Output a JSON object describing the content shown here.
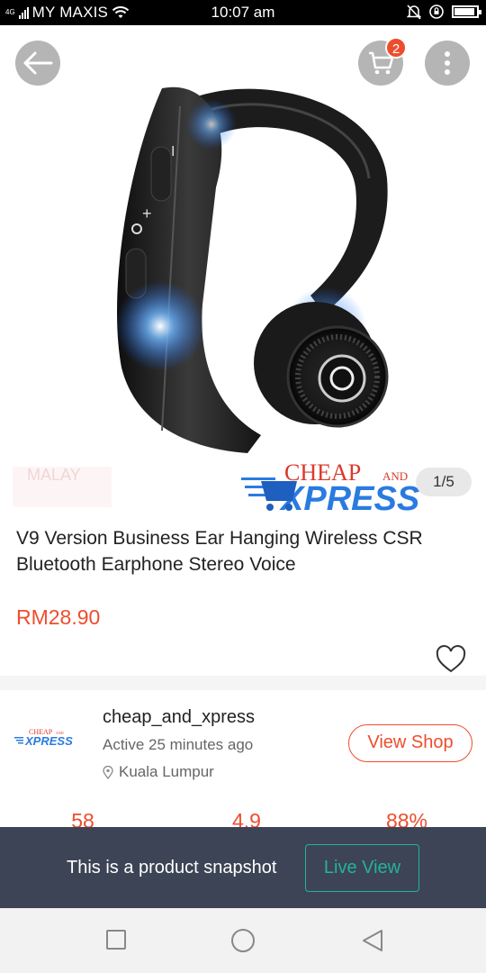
{
  "status_bar": {
    "network": "4G",
    "carrier": "MY MAXIS",
    "time": "10:07 am"
  },
  "header": {
    "cart_count": "2",
    "image_counter": "1/5"
  },
  "product_image": {
    "watermark_brand": "CHEAP AND XPRESS",
    "watermark_left": "MALAY"
  },
  "product": {
    "title": "V9 Version Business Ear Hanging Wireless CSR Bluetooth Earphone Stereo Voice",
    "price": "RM28.90"
  },
  "shop": {
    "logo_text": "CHEAP AND XPRESS",
    "name": "cheap_and_xpress",
    "active": "Active 25 minutes ago",
    "location": "Kuala Lumpur",
    "view_shop_label": "View Shop"
  },
  "stats": [
    {
      "value": "58"
    },
    {
      "value": "4.9"
    },
    {
      "value": "88%"
    }
  ],
  "snapshot": {
    "message": "This is a product snapshot",
    "live_view_label": "Live View"
  },
  "colors": {
    "accent": "#ee4d2d",
    "banner_bg": "#3c4455",
    "live_view": "#24b39b"
  }
}
